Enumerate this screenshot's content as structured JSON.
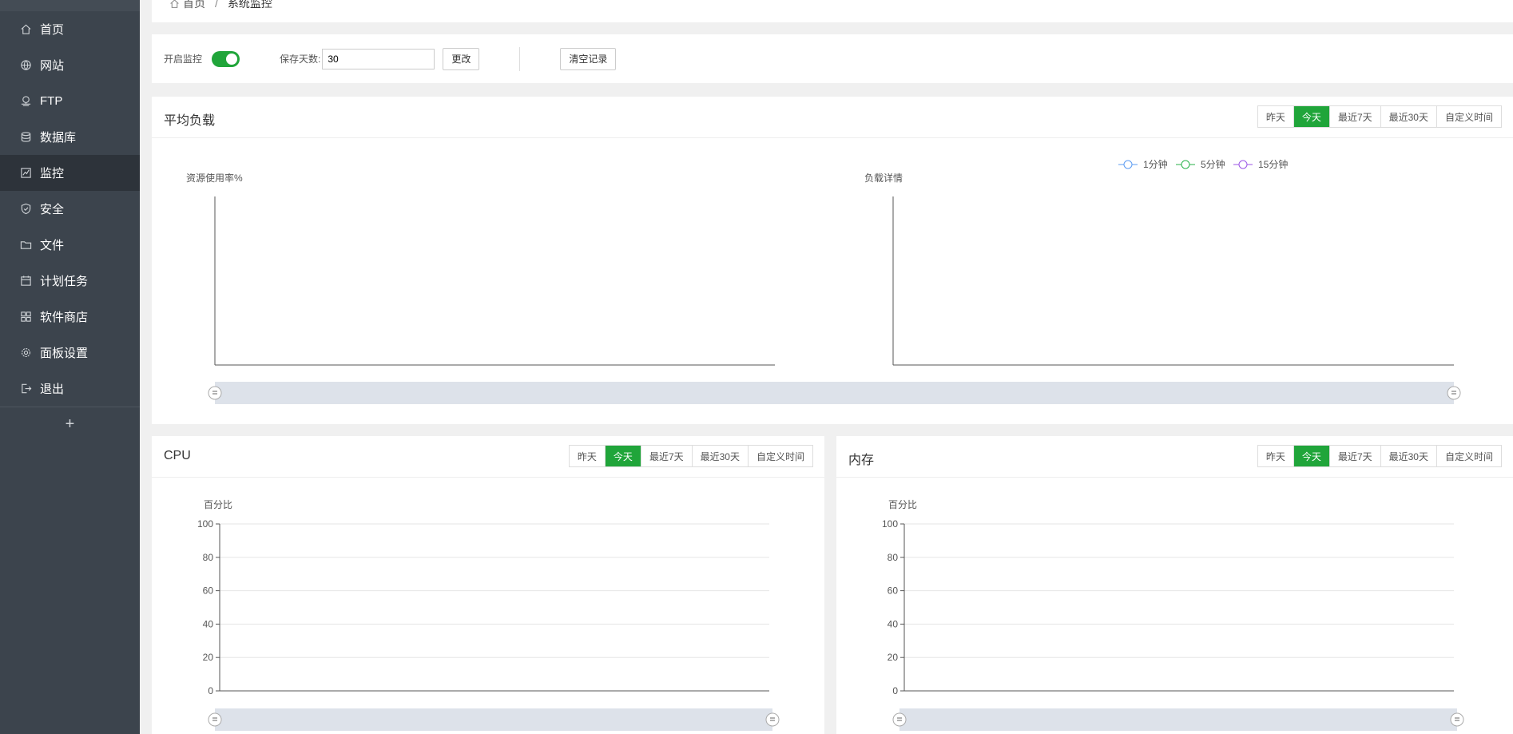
{
  "sidebar": {
    "items": [
      {
        "label": "首页",
        "icon": "home-icon"
      },
      {
        "label": "网站",
        "icon": "globe-icon"
      },
      {
        "label": "FTP",
        "icon": "ftp-icon"
      },
      {
        "label": "数据库",
        "icon": "database-icon"
      },
      {
        "label": "监控",
        "icon": "monitor-icon",
        "active": true
      },
      {
        "label": "安全",
        "icon": "shield-icon"
      },
      {
        "label": "文件",
        "icon": "folder-icon"
      },
      {
        "label": "计划任务",
        "icon": "calendar-icon"
      },
      {
        "label": "软件商店",
        "icon": "grid-icon"
      },
      {
        "label": "面板设置",
        "icon": "gear-icon"
      },
      {
        "label": "退出",
        "icon": "logout-icon"
      }
    ],
    "add_label": "+"
  },
  "breadcrumb": {
    "home": "首页",
    "separator": "/",
    "current": "系统监控"
  },
  "toolbar": {
    "monitor_label": "开启监控",
    "monitor_enabled": true,
    "keep_days_label": "保存天数:",
    "keep_days_value": "30",
    "change_button": "更改",
    "clear_button": "清空记录"
  },
  "range_tabs": [
    "昨天",
    "今天",
    "最近7天",
    "最近30天",
    "自定义时间"
  ],
  "active_tab": "今天",
  "colors": {
    "accent": "#20a53a",
    "sidebar": "#3c444d",
    "load_1": "#5b9bf2",
    "load_5": "#29b24a",
    "load_15": "#9b55e6"
  },
  "panels": {
    "load": {
      "title": "平均负载"
    },
    "cpu": {
      "title": "CPU"
    },
    "memory": {
      "title": "内存"
    }
  },
  "chart_data": [
    {
      "type": "line",
      "title": "",
      "ylabel": "资源使用率%",
      "series": [],
      "grid": false
    },
    {
      "type": "line",
      "title": "",
      "ylabel": "负载详情",
      "legend": [
        "1分钟",
        "5分钟",
        "15分钟"
      ],
      "legend_position": "top",
      "series": [
        {
          "name": "1分钟",
          "values": []
        },
        {
          "name": "5分钟",
          "values": []
        },
        {
          "name": "15分钟",
          "values": []
        }
      ],
      "grid": false
    },
    {
      "type": "line",
      "title": "",
      "ylabel": "百分比",
      "ylim": [
        0,
        100
      ],
      "yticks": [
        0,
        20,
        40,
        60,
        80,
        100
      ],
      "series": [],
      "grid": true
    },
    {
      "type": "line",
      "title": "",
      "ylabel": "百分比",
      "ylim": [
        0,
        100
      ],
      "yticks": [
        0,
        20,
        40,
        60,
        80,
        100
      ],
      "series": [],
      "grid": true
    }
  ]
}
